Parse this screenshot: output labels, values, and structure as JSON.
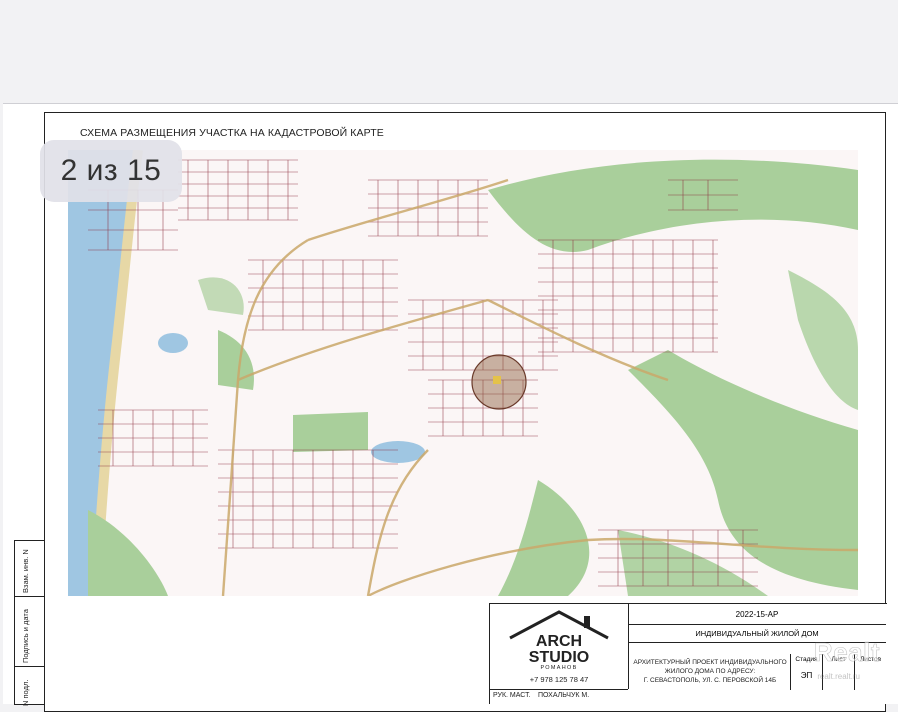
{
  "gallery": {
    "counter": "2 из 15"
  },
  "sheet": {
    "title": "СХЕМА РАЗМЕЩЕНИЯ УЧАСТКА НА КАДАСТРОВОЙ КАРТЕ"
  },
  "side_stamp": {
    "labels": [
      "Взам. инв. N",
      "Подпись и дата",
      "N подл."
    ]
  },
  "title_block": {
    "code": "2022-15-АР",
    "object": "ИНДИВИДУАЛЬНЫЙ ЖИЛОЙ ДОМ",
    "project_lines": [
      "АРХИТЕКТУРНЫЙ ПРОЕКТ ИНДИВИДУАЛЬНОГО",
      "ЖИЛОГО ДОМА ПО АДРЕСУ:",
      "Г. СЕВАСТОПОЛЬ, УЛ. С. ПЕРОВСКОЙ 14Б"
    ],
    "columns": [
      "Стадия",
      "Лист",
      "Листов"
    ],
    "stage": "ЭП",
    "brand_line1": "ARCH",
    "brand_line2": "STUDIO",
    "brand_sub": "РОМАНОВ",
    "phone": "+7 978 125 78 47",
    "role": "РУК. МАСТ.",
    "person": "ПОХАЛЬЧУК М."
  },
  "watermark": {
    "brand": "Realt",
    "site": "realt.realt.ru"
  },
  "colors": {
    "map_bg": "#fbf6f6",
    "green": "#a9cf9b",
    "water": "#9fc6e2",
    "parcel_line": "#8b2b3b",
    "marker_fill": "#8a5a3a"
  }
}
